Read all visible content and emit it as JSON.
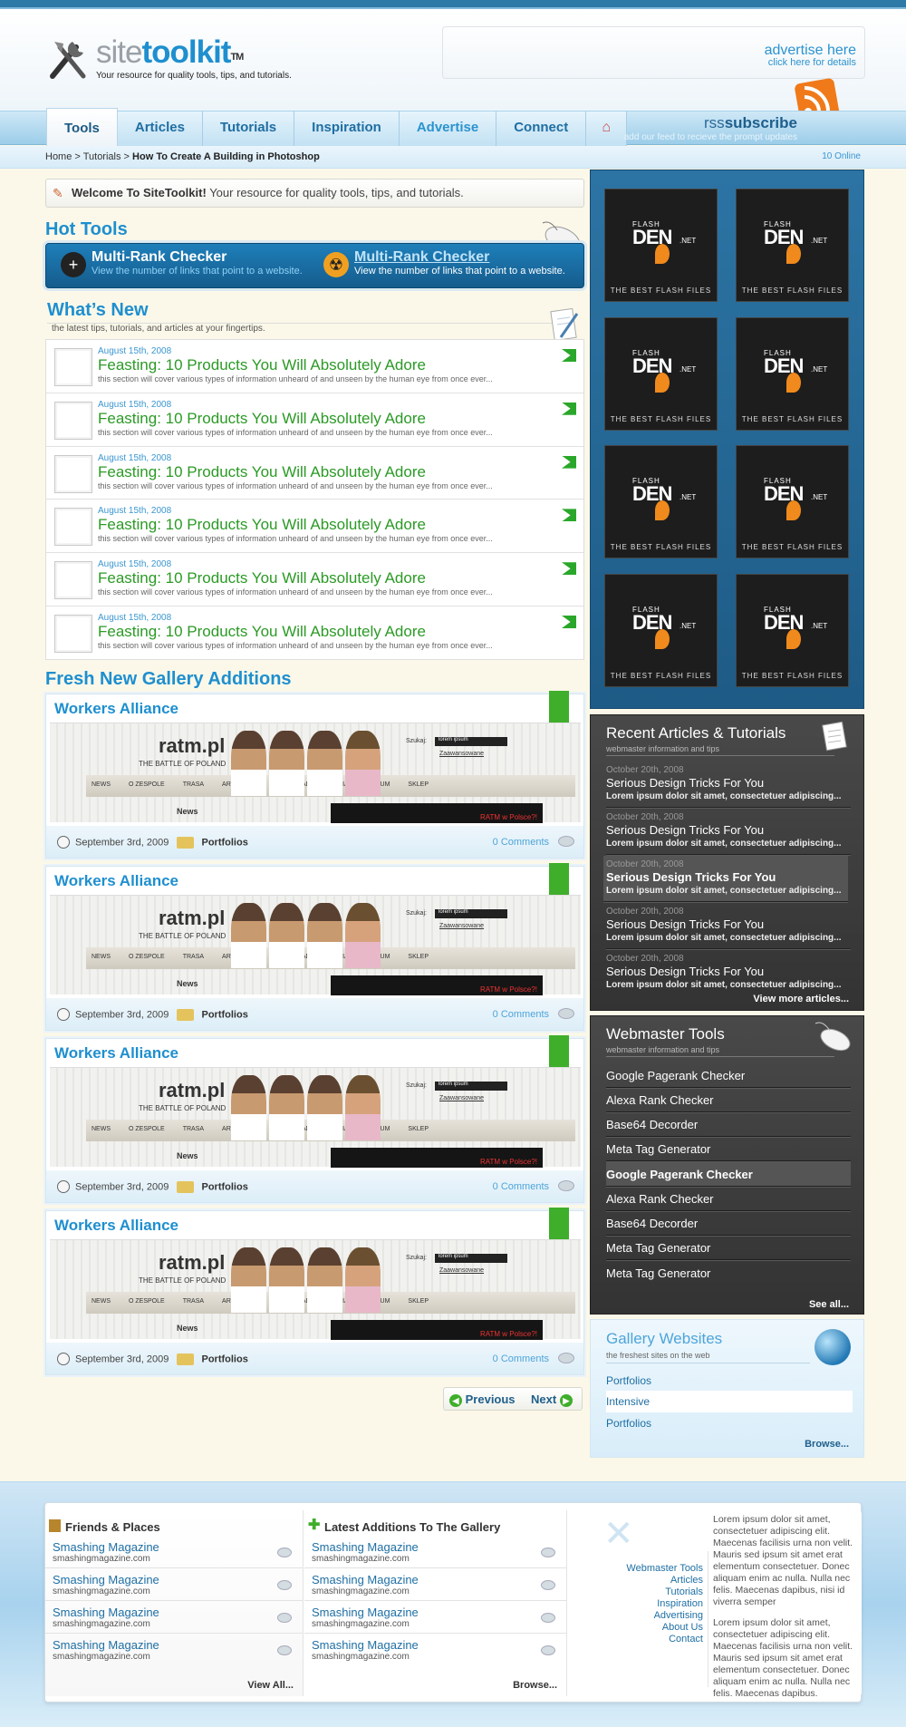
{
  "header": {
    "logo_site": "site",
    "logo_toolkit": "toolkit",
    "logo_tm": "TM",
    "tagline": "Your resource for quality tools, tips, and tutorials.",
    "ad_title": "advertise here",
    "ad_sub": "click here for details"
  },
  "nav": {
    "tabs": [
      "Tools",
      "Articles",
      "Tutorials",
      "Inspiration",
      "Advertise",
      "Connect"
    ],
    "home_icon": "⌂",
    "rss_prefix": "rss",
    "rss_bold": "subscribe",
    "rss_sub": "add our feed to recieve the prompt updates"
  },
  "breadcrumb": {
    "home": "Home",
    "sep": ">",
    "tutorials": "Tutorials",
    "current": "How To Create A Building in Photoshop",
    "online": "10 Online"
  },
  "welcome": {
    "bold": "Welcome To SiteToolkit!",
    "text": "Your resource for quality tools, tips, and tutorials."
  },
  "hot_tools": {
    "heading": "Hot Tools",
    "items": [
      {
        "title": "Multi-Rank Checker",
        "desc": "View the number of links that point to a website."
      },
      {
        "title": "Multi-Rank Checker",
        "desc": "View the number of links that point to a website."
      }
    ]
  },
  "whats_new": {
    "heading": "What’s New",
    "sub": "the latest tips, tutorials, and articles at your fingertips.",
    "items": [
      {
        "date": "August 15th, 2008",
        "title": "Feasting: 10 Products You Will Absolutely Adore",
        "desc": "this section will cover various types of information unheard of and unseen by the human eye from once ever..."
      },
      {
        "date": "August 15th, 2008",
        "title": "Feasting: 10 Products You Will Absolutely Adore",
        "desc": "this section will cover various types of information unheard of and unseen by the human eye from once ever..."
      },
      {
        "date": "August 15th, 2008",
        "title": "Feasting: 10 Products You Will Absolutely Adore",
        "desc": "this section will cover various types of information unheard of and unseen by the human eye from once ever..."
      },
      {
        "date": "August 15th, 2008",
        "title": "Feasting: 10 Products You Will Absolutely Adore",
        "desc": "this section will cover various types of information unheard of and unseen by the human eye from once ever..."
      },
      {
        "date": "August 15th, 2008",
        "title": "Feasting: 10 Products You Will Absolutely Adore",
        "desc": "this section will cover various types of information unheard of and unseen by the human eye from once ever..."
      },
      {
        "date": "August 15th, 2008",
        "title": "Feasting: 10 Products You Will Absolutely Adore",
        "desc": "this section will cover various types of information unheard of and unseen by the human eye from once ever..."
      }
    ]
  },
  "gallery": {
    "heading": "Fresh New Gallery Additions",
    "shot": {
      "ratm": "ratm.pl",
      "sub": "THE BATTLE OF POLAND",
      "menu": [
        "NEWS",
        "O ZESPOLE",
        "TRASA",
        "ARTYKULY",
        "DOWNLOAD",
        "MEDIA",
        "FORUM",
        "SKLEP"
      ],
      "search_label": "Szukaj:",
      "search_value": "lorem ipsum",
      "advanced": "Zaawansowane",
      "news": "News",
      "banner": "RATM w Polsce?!"
    },
    "items": [
      {
        "title": "Workers Alliance",
        "date": "September 3rd, 2009",
        "category": "Portfolios",
        "comments": "0 Comments"
      },
      {
        "title": "Workers Alliance",
        "date": "September 3rd, 2009",
        "category": "Portfolios",
        "comments": "0 Comments"
      },
      {
        "title": "Workers Alliance",
        "date": "September 3rd, 2009",
        "category": "Portfolios",
        "comments": "0 Comments"
      },
      {
        "title": "Workers Alliance",
        "date": "September 3rd, 2009",
        "category": "Portfolios",
        "comments": "0 Comments"
      }
    ]
  },
  "pager": {
    "previous": "Previous",
    "next": "Next"
  },
  "ads": {
    "flash": "FLASH",
    "den": "DEN",
    "net": ".NET",
    "tagline": "THE BEST FLASH FILES"
  },
  "recent": {
    "heading": "Recent Articles & Tutorials",
    "sub": "webmaster information and tips",
    "items": [
      {
        "date": "October 20th, 2008",
        "title": "Serious Design Tricks For You",
        "excerpt": "Lorem ipsum dolor sit amet, consectetuer adipiscing..."
      },
      {
        "date": "October 20th, 2008",
        "title": "Serious Design Tricks For You",
        "excerpt": "Lorem ipsum dolor sit amet, consectetuer adipiscing..."
      },
      {
        "date": "October 20th, 2008",
        "title": "Serious Design Tricks For You",
        "excerpt": "Lorem ipsum dolor sit amet, consectetuer adipiscing..."
      },
      {
        "date": "October 20th, 2008",
        "title": "Serious Design Tricks For You",
        "excerpt": "Lorem ipsum dolor sit amet, consectetuer adipiscing..."
      },
      {
        "date": "October 20th, 2008",
        "title": "Serious Design Tricks For You",
        "excerpt": "Lorem ipsum dolor sit amet, consectetuer adipiscing..."
      }
    ],
    "more": "View more articles..."
  },
  "webmaster": {
    "heading": "Webmaster Tools",
    "sub": "webmaster information and tips",
    "items": [
      "Google Pagerank Checker",
      "Alexa Rank Checker",
      "Base64 Decorder",
      "Meta Tag Generator",
      "Google Pagerank Checker",
      "Alexa Rank Checker",
      "Base64 Decorder",
      "Meta Tag Generator",
      "Meta Tag Generator"
    ],
    "more": "See all..."
  },
  "gallery_websites": {
    "heading": "Gallery Websites",
    "sub": "the freshest sites on the web",
    "items": [
      "Portfolios",
      "Intensive",
      "Portfolios"
    ],
    "more": "Browse..."
  },
  "footer": {
    "friends": {
      "heading": "Friends & Places",
      "items": [
        {
          "name": "Smashing Magazine",
          "url": "smashingmagazine.com"
        },
        {
          "name": "Smashing Magazine",
          "url": "smashingmagazine.com"
        },
        {
          "name": "Smashing Magazine",
          "url": "smashingmagazine.com"
        },
        {
          "name": "Smashing Magazine",
          "url": "smashingmagazine.com"
        }
      ],
      "more": "View All..."
    },
    "latest": {
      "heading": "Latest Additions To The Gallery",
      "items": [
        {
          "name": "Smashing Magazine",
          "url": "smashingmagazine.com"
        },
        {
          "name": "Smashing Magazine",
          "url": "smashingmagazine.com"
        },
        {
          "name": "Smashing Magazine",
          "url": "smashingmagazine.com"
        },
        {
          "name": "Smashing Magazine",
          "url": "smashingmagazine.com"
        }
      ],
      "more": "Browse..."
    },
    "links": [
      "Webmaster Tools",
      "Articles",
      "Tutorials",
      "Inspiration",
      "Advertising",
      "About Us",
      "Contact"
    ],
    "para1": "Lorem ipsum dolor sit amet, consectetuer adipiscing elit. Maecenas facilisis urna non velit. Mauris sed ipsum sit amet erat elementum consectetuer. Donec aliquam enim ac nulla. Nulla nec felis. Maecenas dapibus, nisi id viverra semper",
    "para2": "Lorem ipsum dolor sit amet, consectetuer adipiscing elit. Maecenas facilisis urna non velit. Mauris sed ipsum sit amet erat elementum consectetuer. Donec aliquam enim ac nulla. Nulla nec felis. Maecenas dapibus."
  }
}
